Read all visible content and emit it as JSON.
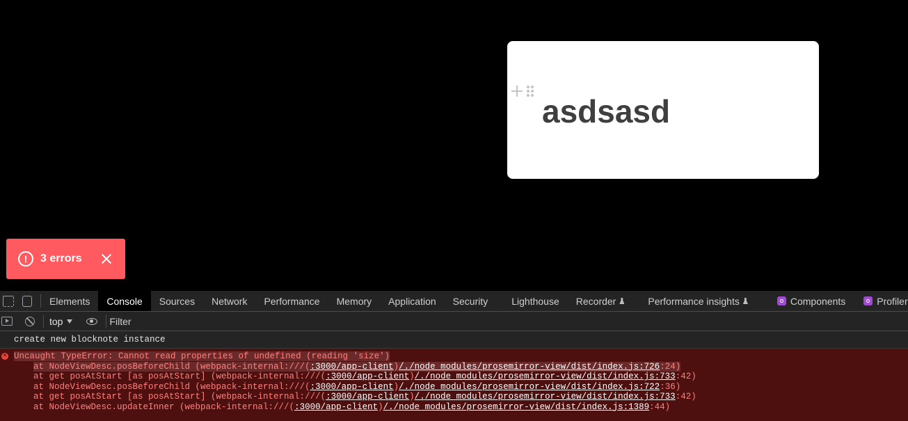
{
  "editor": {
    "heading": "asdsasd",
    "add_block_icon": "plus-icon",
    "drag_handle_icon": "drag-handle-icon"
  },
  "toast": {
    "label": "3 errors",
    "icon": "error-circle-icon",
    "bg_color": "#ff5a5f"
  },
  "devtools": {
    "tabs": [
      {
        "label": "Elements"
      },
      {
        "label": "Console",
        "active": true
      },
      {
        "label": "Sources"
      },
      {
        "label": "Network"
      },
      {
        "label": "Performance"
      },
      {
        "label": "Memory"
      },
      {
        "label": "Application"
      },
      {
        "label": "Security"
      },
      {
        "label": "Lighthouse"
      },
      {
        "label": "Recorder"
      },
      {
        "label": "Performance insights"
      },
      {
        "label": "Components"
      },
      {
        "label": "Profiler"
      }
    ],
    "toolbar": {
      "context": "top",
      "filter_placeholder": "Filter"
    },
    "console": {
      "log": "create new blocknote instance",
      "error_message": "Uncaught TypeError: Cannot read properties of undefined (reading 'size')",
      "stack": [
        {
          "prefix": "at NodeViewDesc.posBeforeChild (webpack-internal:///(",
          "host": ":3000/app-client",
          "mid": ")",
          "path": "/./node_modules/prosemirror-view/dist/index.js:726",
          "suffix": ":24)"
        },
        {
          "prefix": "at get posAtStart [as posAtStart] (webpack-internal:///(",
          "host": ":3000/app-client",
          "mid": ")",
          "path": "/./node_modules/prosemirror-view/dist/index.js:733",
          "suffix": ":42)"
        },
        {
          "prefix": "at NodeViewDesc.posBeforeChild (webpack-internal:///(",
          "host": ":3000/app-client",
          "mid": ")",
          "path": "/./node_modules/prosemirror-view/dist/index.js:722",
          "suffix": ":36)"
        },
        {
          "prefix": "at get posAtStart [as posAtStart] (webpack-internal:///(",
          "host": ":3000/app-client",
          "mid": ")",
          "path": "/./node_modules/prosemirror-view/dist/index.js:733",
          "suffix": ":42)"
        },
        {
          "prefix": "at NodeViewDesc.updateInner (webpack-internal:///(",
          "host": ":3000/app-client",
          "mid": ")",
          "path": "/./node_modules/prosemirror-view/dist/index.js:1389",
          "suffix": ":44)"
        }
      ]
    }
  }
}
